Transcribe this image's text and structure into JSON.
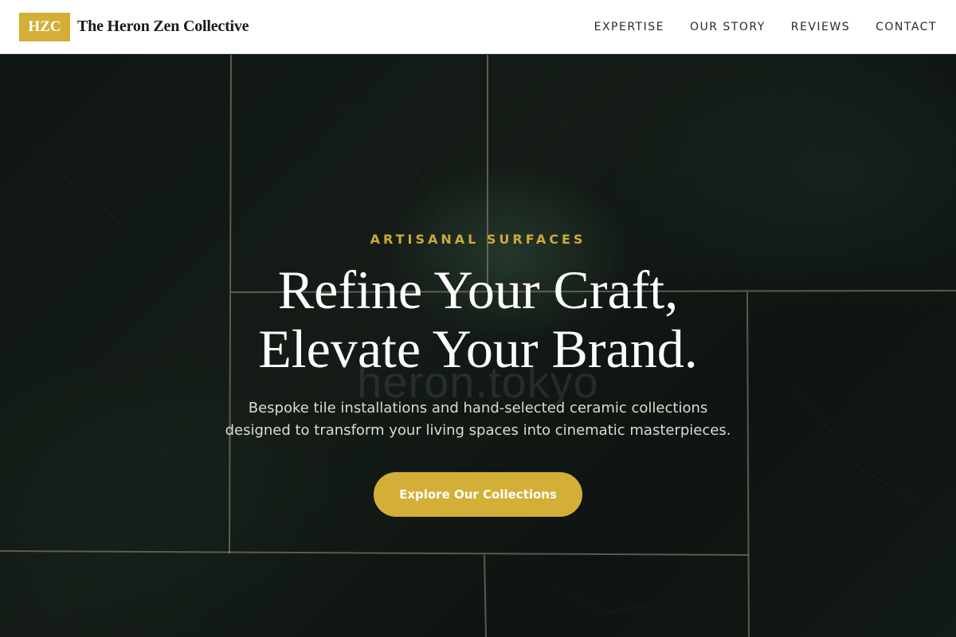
{
  "header": {
    "logo_badge": "HZC",
    "site_name": "The Heron Zen Collective",
    "nav": [
      {
        "label": "EXPERTISE"
      },
      {
        "label": "OUR STORY"
      },
      {
        "label": "REVIEWS"
      },
      {
        "label": "CONTACT"
      }
    ]
  },
  "hero": {
    "eyebrow": "ARTISANAL SURFACES",
    "headline_line1": "Refine Your Craft,",
    "headline_line2": "Elevate Your Brand.",
    "watermark": "heron.tokyo",
    "subtext_line1": "Bespoke tile installations and hand-selected ceramic collections",
    "subtext_line2": "designed to transform your living spaces into cinematic masterpieces.",
    "cta_label": "Explore Our Collections"
  },
  "colors": {
    "accent_gold": "#d4af37",
    "header_bg": "#ffffff",
    "hero_text": "#ffffff",
    "tile_dark_green": "#141c17"
  }
}
